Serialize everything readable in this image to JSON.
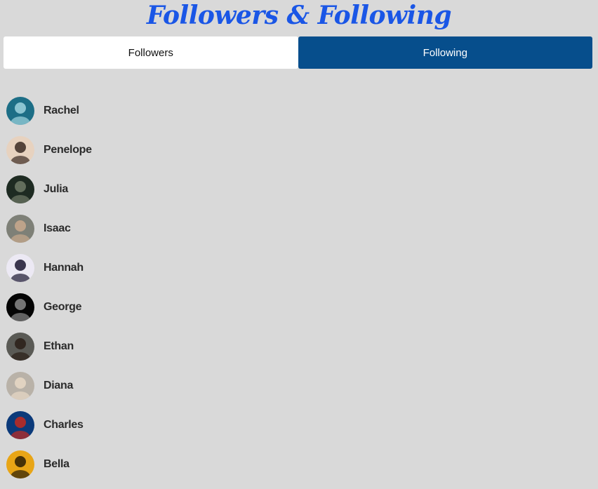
{
  "header": {
    "title": "Followers & Following"
  },
  "tabs": [
    {
      "label": "Followers",
      "active": false
    },
    {
      "label": "Following",
      "active": true
    }
  ],
  "people": [
    {
      "name": "Rachel",
      "avatar_icon": "rachel-avatar-icon",
      "bg": "#1d6e86",
      "fg": "#9fd4de"
    },
    {
      "name": "Penelope",
      "avatar_icon": "penelope-avatar-icon",
      "bg": "#e7d2bf",
      "fg": "#3a2a22"
    },
    {
      "name": "Julia",
      "avatar_icon": "julia-avatar-icon",
      "bg": "#1e2b22",
      "fg": "#6f7a66"
    },
    {
      "name": "Isaac",
      "avatar_icon": "isaac-avatar-icon",
      "bg": "#7e8077",
      "fg": "#c9a98d"
    },
    {
      "name": "Hannah",
      "avatar_icon": "hannah-avatar-icon",
      "bg": "#ece9f4",
      "fg": "#1b1530"
    },
    {
      "name": "George",
      "avatar_icon": "george-avatar-icon",
      "bg": "#050505",
      "fg": "#8a8a8a"
    },
    {
      "name": "Ethan",
      "avatar_icon": "ethan-avatar-icon",
      "bg": "#5a5a55",
      "fg": "#2a1e17"
    },
    {
      "name": "Diana",
      "avatar_icon": "diana-avatar-icon",
      "bg": "#b9b2a8",
      "fg": "#e8d8c6"
    },
    {
      "name": "Charles",
      "avatar_icon": "charles-avatar-icon",
      "bg": "#0b3a7a",
      "fg": "#c42a1f"
    },
    {
      "name": "Bella",
      "avatar_icon": "bella-avatar-icon",
      "bg": "#e8a516",
      "fg": "#2a1d05"
    }
  ],
  "colors": {
    "background": "#d9d9d9",
    "title": "#1a56e6",
    "tab_active_bg": "#064e8c",
    "tab_inactive_bg": "#ffffff"
  }
}
